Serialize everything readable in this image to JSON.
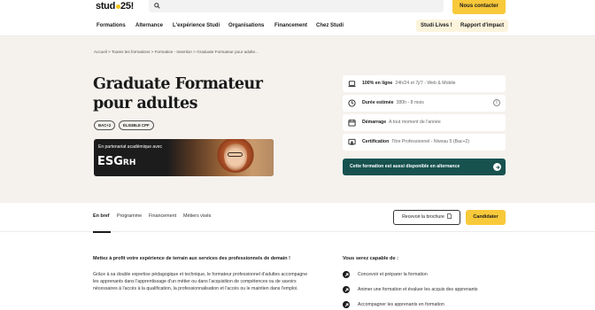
{
  "brand": {
    "logo_text": "stud",
    "logo_suffix": "25!"
  },
  "topbar": {
    "contact_label": "Nous contacter"
  },
  "nav": {
    "items": [
      "Formations",
      "Alternance",
      "L'expérience Studi",
      "Organisations",
      "Financement",
      "Chez Studi"
    ],
    "pills": [
      "Studi Lives !",
      "Rapport d'impact"
    ]
  },
  "hero": {
    "breadcrumb": "Accueil > Toutes les formations > Formation - Insertion > Graduate Formateur pour adulte...",
    "title_line1": "Graduate Formateur",
    "title_line2": "pour adultes",
    "badges": [
      "BAC+2",
      "ÉLIGIBLE CPF"
    ],
    "partner": {
      "label": "En partenariat académique avec",
      "logo": "ESG",
      "logo_suffix": "RH"
    }
  },
  "info": {
    "cards": [
      {
        "label": "100% en ligne",
        "value": "24h/24 et 7j/7 - Web & Mobile",
        "icon": "laptop-icon"
      },
      {
        "label": "Durée estimée",
        "value": "380h - 8 mois",
        "icon": "clock-icon",
        "info": "i"
      },
      {
        "label": "Démarrage",
        "value": "A tout moment de l'année",
        "icon": "calendar-icon"
      },
      {
        "label": "Certification",
        "value": "Titre Professionnel - Niveau 5 (Bac+2)",
        "icon": "certificate-icon"
      }
    ],
    "alternance_label": "Cette formation est aussi disponible en alternance",
    "accent": "#17524f"
  },
  "tabs": {
    "items": [
      "En bref",
      "Programme",
      "Financement",
      "Métiers visés"
    ],
    "brochure_label": "Recevoir la brochure",
    "apply_label": "Candidater"
  },
  "content": {
    "lead": "Mettez à profit votre expérience de terrain aux services des professionnels de demain !",
    "paragraph": "Grâce à sa double expertise pédagogique et technique, le formateur professionnel d'adultes accompagne les apprenants dans l'apprentissage d'un métier ou dans l'acquisition de compétences ou de savoirs nécessaires à l'accès à la qualification, la professionnalisation et l'accès ou le maintien dans l'emploi.",
    "skills_title": "Vous serez capable de :",
    "skills": [
      "Concevoir et préparer la formation",
      "Animer une formation et évaluer les acquis des apprenants",
      "Accompagner les apprenants en formation"
    ]
  },
  "colors": {
    "yellow": "#f8c93a",
    "hero_bg": "#f5f2ee",
    "teal": "#17524f"
  }
}
